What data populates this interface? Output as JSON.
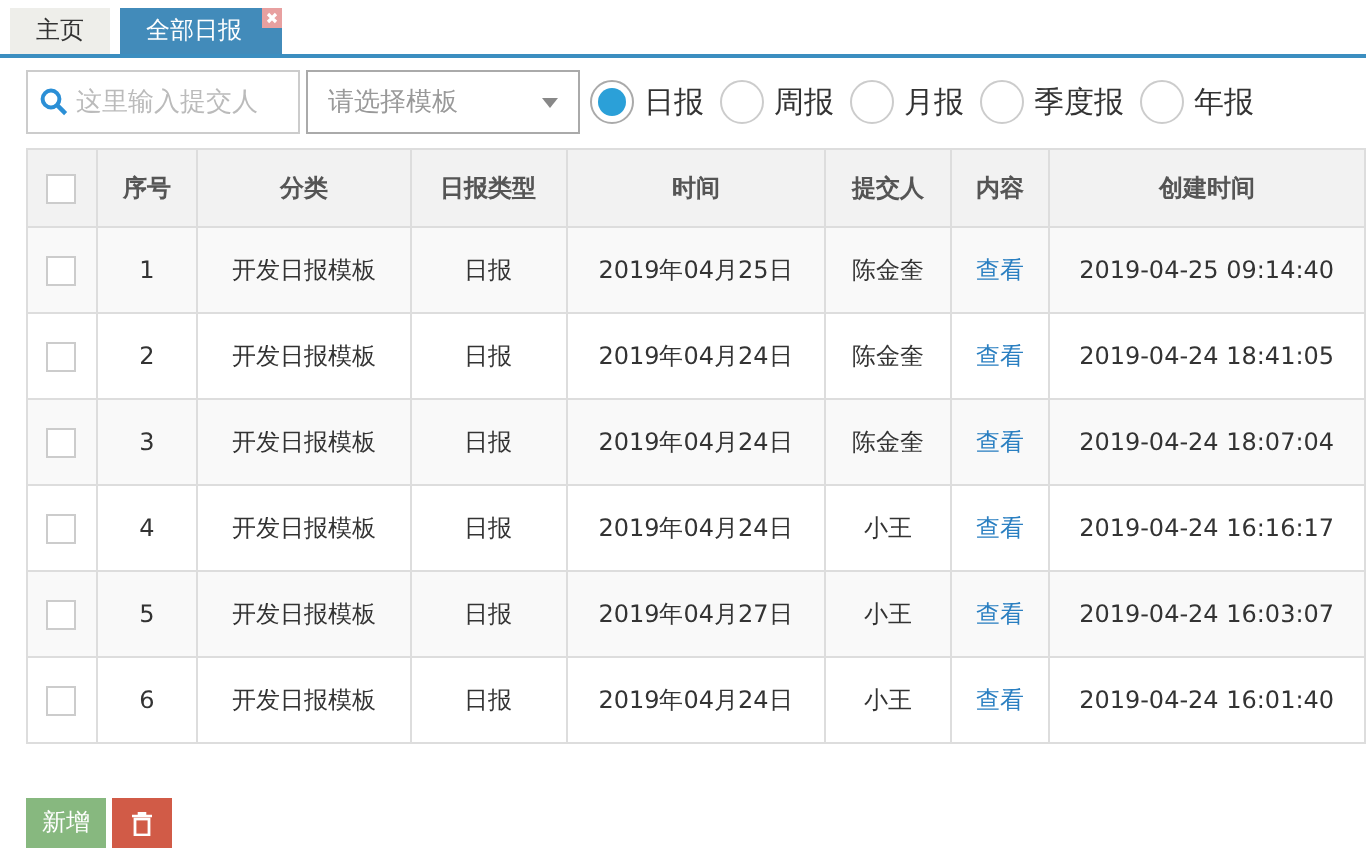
{
  "tabs": [
    {
      "label": "主页",
      "selected": false,
      "closable": false
    },
    {
      "label": "全部日报",
      "selected": true,
      "closable": true
    }
  ],
  "search": {
    "placeholder": "这里输入提交人"
  },
  "template_select": {
    "placeholder": "请选择模板"
  },
  "report_types": [
    {
      "label": "日报",
      "selected": true
    },
    {
      "label": "周报",
      "selected": false
    },
    {
      "label": "月报",
      "selected": false
    },
    {
      "label": "季度报",
      "selected": false
    },
    {
      "label": "年报",
      "selected": false
    }
  ],
  "table": {
    "select_all_checked": false,
    "columns": [
      "序号",
      "分类",
      "日报类型",
      "时间",
      "提交人",
      "内容",
      "创建时间"
    ],
    "rows": [
      {
        "checked": false,
        "cells": [
          "1",
          "开发日报模板",
          "日报",
          "2019年04月25日",
          "陈金奎",
          "查看",
          "2019-04-25 09:14:40"
        ]
      },
      {
        "checked": false,
        "cells": [
          "2",
          "开发日报模板",
          "日报",
          "2019年04月24日",
          "陈金奎",
          "查看",
          "2019-04-24 18:41:05"
        ]
      },
      {
        "checked": false,
        "cells": [
          "3",
          "开发日报模板",
          "日报",
          "2019年04月24日",
          "陈金奎",
          "查看",
          "2019-04-24 18:07:04"
        ]
      },
      {
        "checked": false,
        "cells": [
          "4",
          "开发日报模板",
          "日报",
          "2019年04月24日",
          "小王",
          "查看",
          "2019-04-24 16:16:17"
        ]
      },
      {
        "checked": false,
        "cells": [
          "5",
          "开发日报模板",
          "日报",
          "2019年04月27日",
          "小王",
          "查看",
          "2019-04-24 16:03:07"
        ]
      },
      {
        "checked": false,
        "cells": [
          "6",
          "开发日报模板",
          "日报",
          "2019年04月24日",
          "小王",
          "查看",
          "2019-04-24 16:01:40"
        ]
      }
    ]
  },
  "add_button": "新增"
}
